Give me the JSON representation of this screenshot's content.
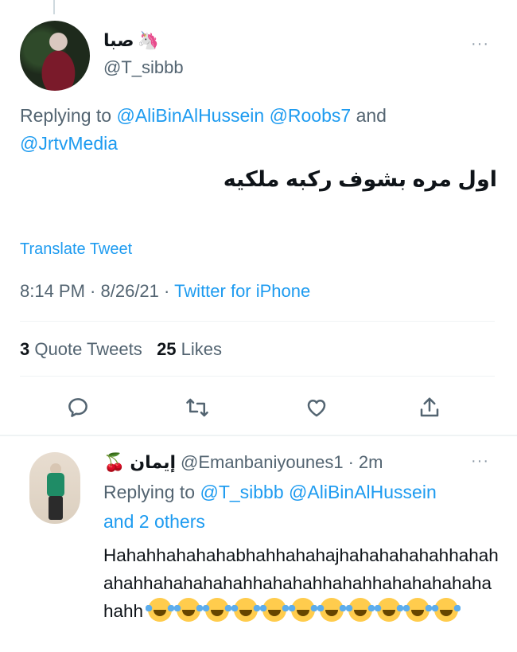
{
  "main_tweet": {
    "display_name": "صبا",
    "name_emoji": "🦄",
    "handle": "@T_sibbb",
    "replying_prefix": "Replying to ",
    "mentions": [
      "@AliBinAlHussein",
      "@Roobs7",
      "@JrtvMedia"
    ],
    "replying_and": " and ",
    "text": "اول مره بشوف ركبه ملكيه",
    "translate_label": "Translate Tweet",
    "time": "8:14 PM",
    "date": "8/26/21",
    "source": "Twitter for iPhone",
    "quote_count": "3",
    "quote_label": "Quote Tweets",
    "like_count": "25",
    "like_label": "Likes",
    "more_label": "···"
  },
  "actions": [
    {
      "name": "reply-icon"
    },
    {
      "name": "retweet-icon"
    },
    {
      "name": "like-icon"
    },
    {
      "name": "share-icon"
    }
  ],
  "reply_tweet": {
    "display_name": "إيمان",
    "name_emoji": "🍒",
    "handle": "@Emanbaniyounes1",
    "time_ago": "2m",
    "replying_prefix": "Replying to ",
    "mentions": [
      "@T_sibbb",
      "@AliBinAlHussein"
    ],
    "others": "and 2 others",
    "text": "Hahahhahahahabhahhahahajhahahahahahhahahahahhahahahahahhahahahhahahhahahahahahahahh",
    "emoji_count": 11,
    "more_label": "···"
  }
}
